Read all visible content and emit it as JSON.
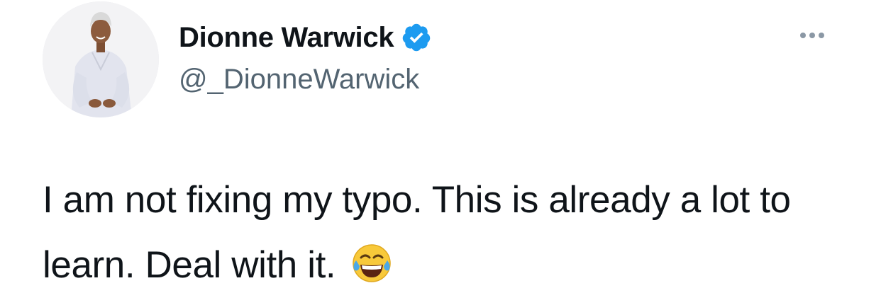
{
  "tweet": {
    "author": {
      "display_name": "Dionne Warwick",
      "handle": "@_DionneWarwick",
      "verified_icon": "verified-badge-icon",
      "verified_color": "#1d9bf0"
    },
    "text": "I am not fixing my typo. This is already a lot to learn. Deal with it.",
    "emoji_icon": "face-with-tears-of-joy-icon",
    "more_icon": "more-options-icon"
  },
  "colors": {
    "text": "#0f1419",
    "secondary_text": "#536471",
    "background": "#ffffff"
  }
}
